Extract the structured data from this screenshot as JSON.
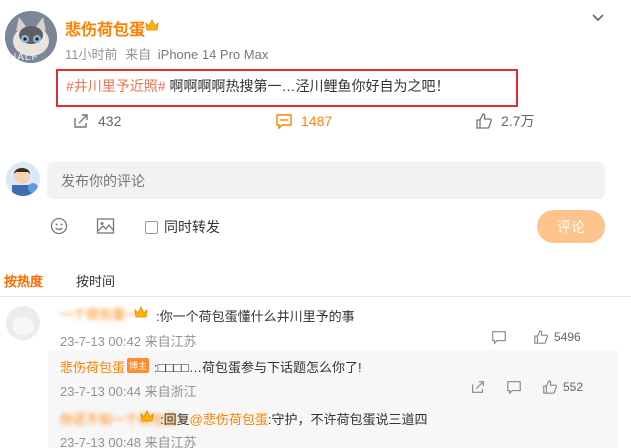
{
  "post": {
    "author": "悲伤荷包蛋",
    "time": "11小时前",
    "source_prefix": "来自",
    "device": "iPhone 14 Pro Max",
    "hashtag": "#井川里予近照#",
    "text": " 啊啊啊啊热搜第一…泾川鲤鱼你好自为之吧！",
    "avatar_text": "HALF",
    "share_count": "432",
    "comment_count": "1487",
    "like_count": "2.7万"
  },
  "composer": {
    "placeholder": "发布你的评论",
    "repost_label": "同时转发",
    "submit_label": "评论"
  },
  "sort": {
    "hot": "按热度",
    "time": "按时间"
  },
  "comments": [
    {
      "name": "一个荷包蛋一",
      "text": ":你一个荷包蛋懂什么井川里予的事",
      "time": "23-7-13 00:42 来自江苏",
      "likes": "5496"
    }
  ],
  "replies": [
    {
      "name": "悲伤荷包蛋",
      "badge": "博主",
      "text": ":□□□□…荷包蛋参与下话题怎么你了!",
      "time": "23-7-13 00:44 来自浙江",
      "likes": "552"
    },
    {
      "name": "你还不如一个荷包蛋一",
      "reply_prefix": ":回复",
      "mention": "@悲伤荷包蛋",
      "text": ":守护，不许荷包蛋说三道四",
      "time": "23-7-13 00:48 来自江苏"
    }
  ],
  "colors": {
    "accent": "#ff8200",
    "hashtag": "#eb7350",
    "highlight_box": "#e02d2d",
    "submit_bg": "#ffc48d"
  }
}
